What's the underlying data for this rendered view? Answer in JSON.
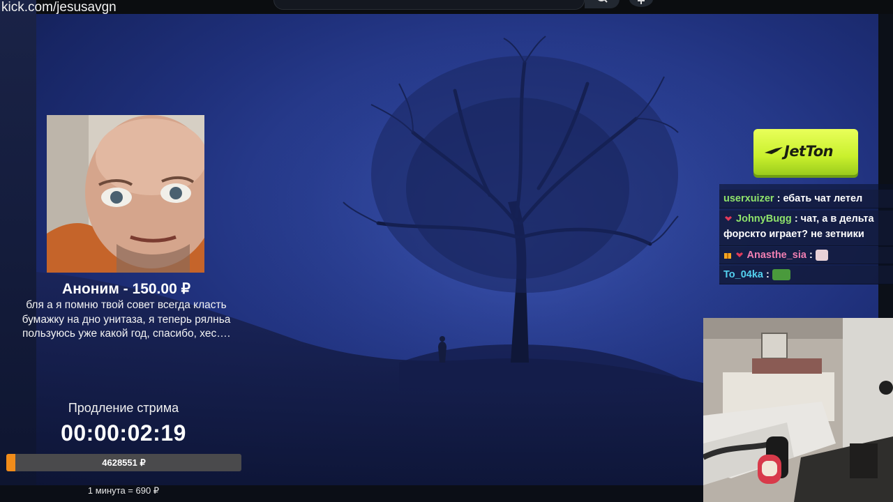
{
  "channel_url": "kick.com/jesusavgn",
  "donation": {
    "title": "Аноним - 150.00 ₽",
    "message": "бля а я помню твой совет всегда класть бумажку на дно унитаза, я теперь рялньа пользуюсь уже какой год, спасибо, хес…."
  },
  "extension": {
    "label": "Продление стрима",
    "timer": "00:00:02:19",
    "progress_text": "4628551 ₽",
    "progress_fraction": 0.04,
    "rate": "1 минута = 690 ₽"
  },
  "sponsor": {
    "name": "JetTon"
  },
  "chat": [
    {
      "user": "userxuizer",
      "color": "#8fe36b",
      "text": "ебать чат летел",
      "badges": []
    },
    {
      "user": "JohnyBugg",
      "color": "#8fe36b",
      "text": "чат, а в дельта",
      "text2": "форскто играет? не зетники",
      "badges": [
        "heart"
      ]
    },
    {
      "user": "Anasthe_sia",
      "color": "#f07fb2",
      "text": "",
      "badges": [
        "gift",
        "heart"
      ],
      "emote": "cat-emote"
    },
    {
      "user": "To_04ka",
      "color": "#54d2f0",
      "text": "",
      "badges": [],
      "emote": "pepe-emote"
    }
  ],
  "colors": {
    "accent_orange": "#f18c1a",
    "sponsor_green": "#c9f02d"
  }
}
